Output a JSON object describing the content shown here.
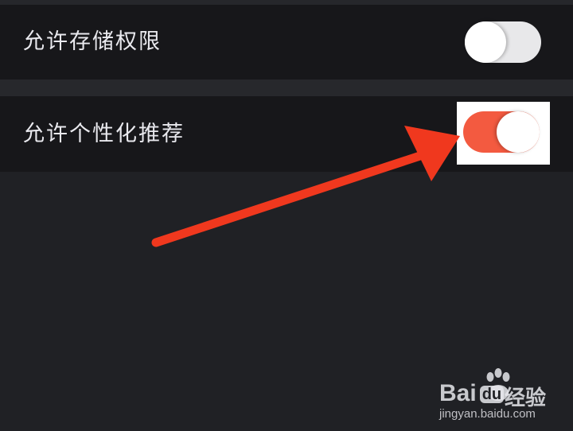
{
  "settings": {
    "items": [
      {
        "label": "允许存储权限",
        "enabled": false
      },
      {
        "label": "允许个性化推荐",
        "enabled": true
      }
    ]
  },
  "colors": {
    "background": "#202125",
    "row_background": "#17171a",
    "toggle_on": "#f35a40",
    "toggle_off": "#e8e8ea",
    "arrow": "#f0381e"
  },
  "watermark": {
    "brand_left": "Bai",
    "brand_mid": "du",
    "brand_right": "经验",
    "url": "jingyan.baidu.com"
  }
}
